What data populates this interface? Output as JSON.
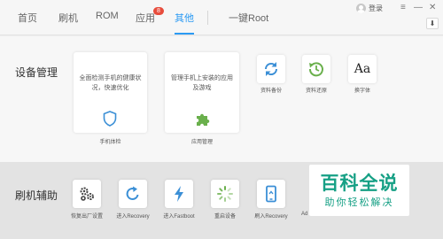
{
  "nav": {
    "tabs": [
      {
        "label": "首页"
      },
      {
        "label": "刷机"
      },
      {
        "label": "ROM"
      },
      {
        "label": "应用",
        "badge": "8"
      },
      {
        "label": "其他"
      },
      {
        "label": "一键Root"
      }
    ],
    "active_tab": "其他",
    "login_label": "登录",
    "menu_icon": "≡",
    "minimize_icon": "—",
    "close_icon": "✕",
    "download_icon": "⬇"
  },
  "device_mgmt": {
    "title": "设备管理",
    "big_cards": [
      {
        "text": "全面检测手机的健康状况，快速优化",
        "label": "手机体检",
        "icon": "shield-icon"
      },
      {
        "text": "管理手机上安装的应用及游戏",
        "label": "应用管理",
        "icon": "puzzle-icon"
      }
    ],
    "small_items": [
      {
        "label": "资料备份",
        "icon": "sync-icon"
      },
      {
        "label": "资料还原",
        "icon": "restore-clock-icon"
      },
      {
        "label": "换字体",
        "icon": "font-icon",
        "glyph": "Aa"
      }
    ]
  },
  "flash_assist": {
    "title": "刷机辅助",
    "items": [
      {
        "label": "恢复出厂设置",
        "icon": "gears-icon"
      },
      {
        "label": "进入Recovery",
        "icon": "refresh-icon"
      },
      {
        "label": "进入Fastboot",
        "icon": "lightning-icon"
      },
      {
        "label": "重启设备",
        "icon": "spinner-icon"
      },
      {
        "label": "刷入Recovery",
        "icon": "phone-icon"
      },
      {
        "label": "Ad",
        "icon": "adb-icon"
      }
    ]
  },
  "watermark": {
    "big": "百科全说",
    "small": "助你轻松解决"
  },
  "colors": {
    "accent": "#2b9af3",
    "icon_blue": "#3b8fd6",
    "icon_green": "#6ab04c",
    "badge": "#e74c3c",
    "watermark": "#16a085"
  }
}
